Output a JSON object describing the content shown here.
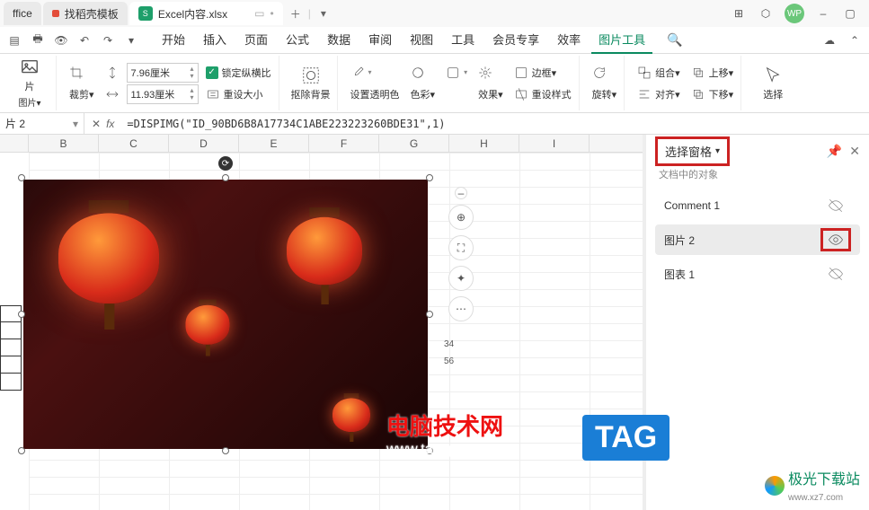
{
  "titlebar": {
    "app_tab": "ffice",
    "tab1": "找稻壳模板",
    "tab2": "Excel内容.xlsx",
    "user_badge": "WP"
  },
  "menu": {
    "tabs": [
      "开始",
      "插入",
      "页面",
      "公式",
      "数据",
      "审阅",
      "视图",
      "工具",
      "会员专享",
      "效率",
      "图片工具"
    ],
    "active_index": 10
  },
  "ribbon": {
    "pic_label": "片",
    "pic_sub": "图片▾",
    "crop": "裁剪▾",
    "height": "7.96厘米",
    "width": "11.93厘米",
    "lock_ratio": "锁定纵横比",
    "reset_size": "重设大小",
    "remove_bg": "抠除背景",
    "set_transparent": "设置透明色",
    "color": "色彩▾",
    "effect": "效果▾",
    "border": "边框▾",
    "reset_style": "重设样式",
    "rotate": "旋转▾",
    "group": "组合▾",
    "align": "对齐▾",
    "move_up": "上移▾",
    "move_down": "下移▾",
    "select": "选择"
  },
  "formula": {
    "namebox": "片 2",
    "fx": "fx",
    "formula": "=DISPIMG(\"ID_90BD6B8A17734C1ABE223223260BDE31\",1)"
  },
  "columns": [
    "B",
    "C",
    "D",
    "E",
    "F",
    "G",
    "H",
    "I"
  ],
  "peek_values": [
    "34",
    "56"
  ],
  "sidepanel": {
    "title": "选择窗格",
    "subtitle": "文档中的对象",
    "items": [
      {
        "name": "Comment 1",
        "visible": false,
        "selected": false
      },
      {
        "name": "图片 2",
        "visible": true,
        "selected": true,
        "hl": true
      },
      {
        "name": "图表 1",
        "visible": false,
        "selected": false
      }
    ]
  },
  "watermark": {
    "w1_line1": "电脑技术网",
    "w1_line2": "www.tagxp.com",
    "w2": "TAG",
    "w3": "极光下载站",
    "w3_sub": "www.xz7.com"
  },
  "icons": {
    "close": "×",
    "add": "+",
    "dropdown": "▾",
    "search": "🔍",
    "pin": "📌",
    "minimize": "–",
    "box": "▢"
  }
}
